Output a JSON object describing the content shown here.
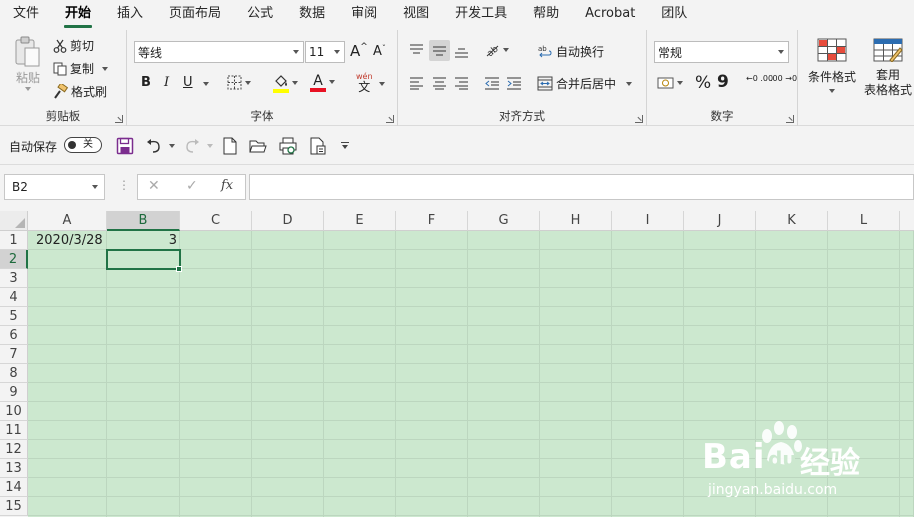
{
  "menu": {
    "items": [
      "文件",
      "开始",
      "插入",
      "页面布局",
      "公式",
      "数据",
      "审阅",
      "视图",
      "开发工具",
      "帮助",
      "Acrobat",
      "团队"
    ],
    "active_index": 1
  },
  "ribbon": {
    "clipboard": {
      "label": "剪贴板",
      "paste": "粘贴",
      "cut": "剪切",
      "copy": "复制",
      "format_painter": "格式刷"
    },
    "font": {
      "label": "字体",
      "font_name": "等线",
      "font_size": "11",
      "bold": "B",
      "italic": "I",
      "underline": "U",
      "grow": "A",
      "shrink": "A",
      "wen": "wén",
      "wen_char": "文"
    },
    "alignment": {
      "label": "对齐方式",
      "wrap_text": "自动换行",
      "merge_center": "合并后居中"
    },
    "number": {
      "label": "数字",
      "format": "常规",
      "percent": "%",
      "comma": "9",
      "inc_decimal": "←0 .00",
      "dec_decimal": ".00 →0"
    },
    "styles": {
      "conditional_format": "条件格式",
      "table_format_line1": "套用",
      "table_format_line2": "表格格式"
    }
  },
  "qat": {
    "autosave_label": "自动保存",
    "autosave_state": "关"
  },
  "formula_bar": {
    "name_box": "B2",
    "fx": "fx",
    "cancel": "✕",
    "confirm": "✓",
    "content": ""
  },
  "sheet": {
    "columns": [
      "A",
      "B",
      "C",
      "D",
      "E",
      "F",
      "G",
      "H",
      "I",
      "J",
      "K",
      "L"
    ],
    "rows": [
      "1",
      "2",
      "3",
      "4",
      "5",
      "6",
      "7",
      "8",
      "9",
      "10",
      "11",
      "12",
      "13",
      "14",
      "15"
    ],
    "selected_column": "B",
    "selected_row": "2",
    "cells": {
      "A1": "2020/3/28",
      "B1": "3"
    }
  },
  "watermark": {
    "brand": "Bai",
    "brand2": "du",
    "brand_cn": "经验",
    "url": "jingyan.baidu.com"
  },
  "colors": {
    "accent": "#217346",
    "sheet_bg": "#cce8cf",
    "font_highlight": "#ffff00",
    "font_color": "#e81123"
  }
}
